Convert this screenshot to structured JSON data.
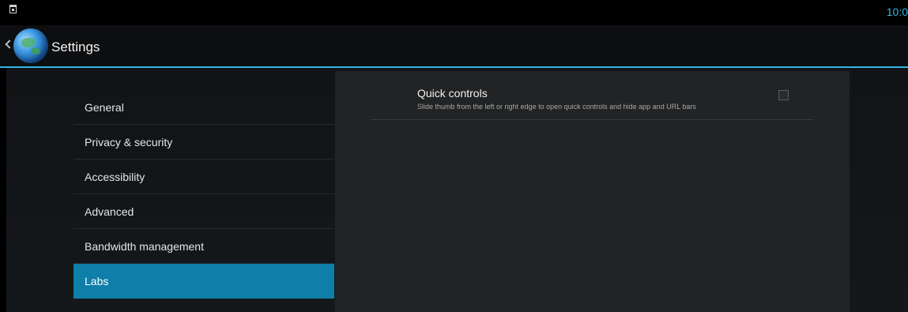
{
  "status_bar": {
    "notification_icon": "sd-card-icon",
    "clock": "10:0"
  },
  "action_bar": {
    "title": "Settings",
    "app_icon": "browser-globe-icon",
    "up_icon": "chevron-left-icon"
  },
  "headers": [
    {
      "label": "General"
    },
    {
      "label": "Privacy & security"
    },
    {
      "label": "Accessibility"
    },
    {
      "label": "Advanced"
    },
    {
      "label": "Bandwidth management"
    },
    {
      "label": "Labs"
    }
  ],
  "selected_header": "Labs",
  "detail": {
    "preference": {
      "title": "Quick controls",
      "summary": "Slide thumb from the left or right edge to open quick controls and hide app and URL bars",
      "checked": false
    }
  },
  "colors": {
    "accent": "#33b5e5",
    "selected": "#0e7fa8"
  }
}
